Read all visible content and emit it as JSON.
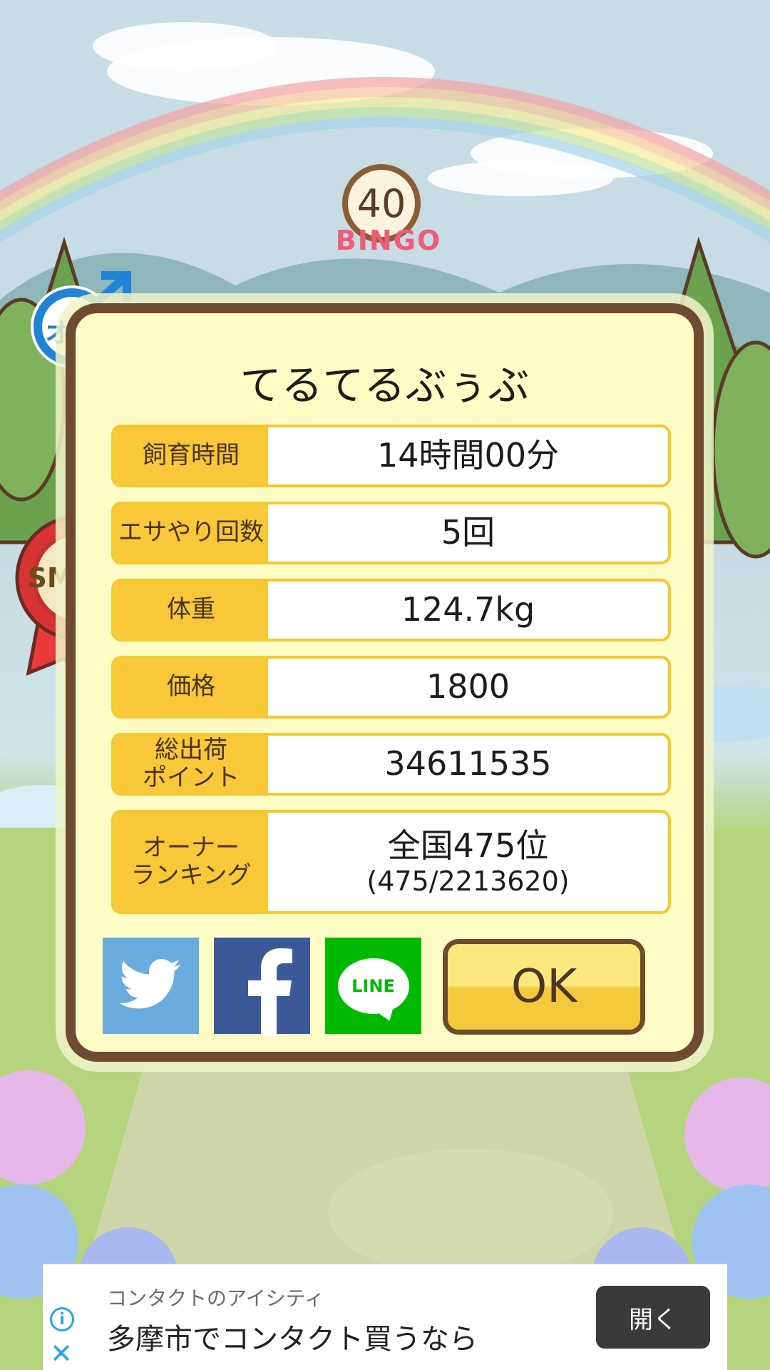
{
  "bingo": {
    "number": "40",
    "label": "BINGO"
  },
  "gender_badge": {
    "label": "オス"
  },
  "size_badge": {
    "label": "SMALL"
  },
  "dialog": {
    "title": "てるてるぶぅぶ",
    "rows": [
      {
        "label": "飼育時間",
        "value": "14時間00分"
      },
      {
        "label": "エサやり回数",
        "value": "5回"
      },
      {
        "label": "体重",
        "value": "124.7kg"
      },
      {
        "label": "価格",
        "value": "1800"
      },
      {
        "label": "総出荷\nポイント",
        "value": "34611535"
      },
      {
        "label": "オーナー\nランキング",
        "value": "全国475位",
        "sub": "(475/2213620)"
      }
    ],
    "share": {
      "twitter_icon": "twitter-bird-icon",
      "facebook_icon": "facebook-f-icon",
      "line_label": "LINE"
    },
    "ok_label": "OK"
  },
  "ad": {
    "advertiser": "コンタクトのアイシティ",
    "headline": "多摩市でコンタクト買うなら",
    "open_label": "開く",
    "info_icon": "info-icon",
    "close_icon": "close-icon"
  },
  "colors": {
    "panel_bg": "#fffcc5",
    "panel_border": "#6f4b31",
    "label_bg": "#f8c838",
    "ok_top": "#fbe980",
    "ok_bottom": "#f3c83b",
    "twitter": "#6aacde",
    "facebook": "#3b5998",
    "line": "#00b900"
  }
}
